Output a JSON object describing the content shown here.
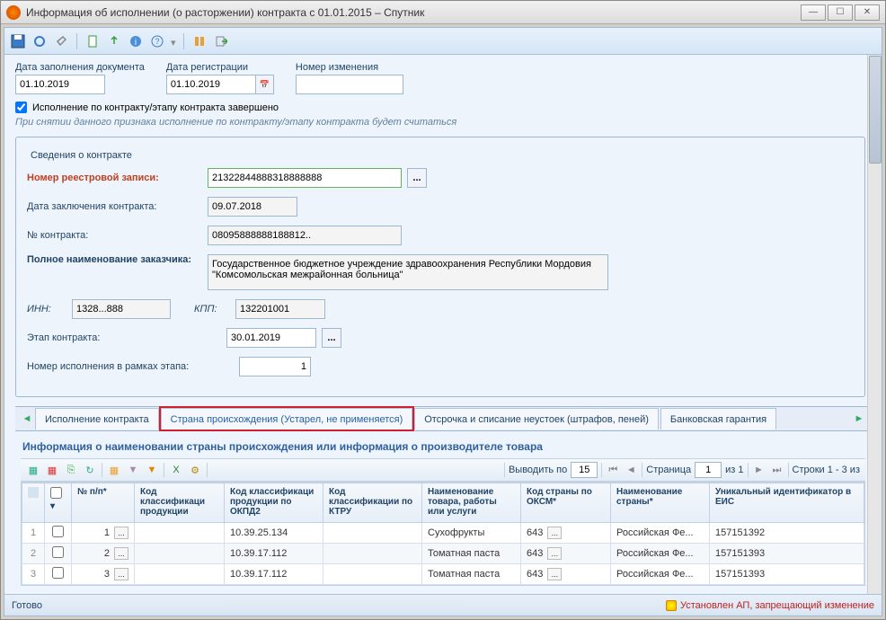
{
  "window": {
    "title": "Информация об исполнении (о расторжении) контракта с 01.01.2015 – Спутник"
  },
  "header": {
    "fill_date_label": "Дата заполнения документа",
    "fill_date": "01.10.2019",
    "reg_date_label": "Дата регистрации",
    "reg_date": "01.10.2019",
    "change_num_label": "Номер изменения",
    "change_num": ""
  },
  "checkbox": {
    "label": "Исполнение по контракту/этапу контракта завершено"
  },
  "note": "При снятии данного признака исполнение по контракту/этапу контракта будет считаться",
  "contract": {
    "legend": "Сведения о контракте",
    "reg_num_label": "Номер реестровой записи:",
    "reg_num": "21322844888318888888",
    "date_label": "Дата заключения контракта:",
    "date": "09.07.2018",
    "num_label": "№ контракта:",
    "num": "08095888888188812..",
    "customer_label": "Полное наименование заказчика:",
    "customer": "Государственное бюджетное учреждение здравоохранения Республики Мордовия \"Комсомольская межрайонная больница\"",
    "inn_label": "ИНН:",
    "inn": "1328...888",
    "kpp_label": "КПП:",
    "kpp": "132201001",
    "stage_label": "Этап контракта:",
    "stage": "30.01.2019",
    "exec_num_label": "Номер исполнения в рамках этапа:",
    "exec_num": "1"
  },
  "tabs": {
    "t1": "Исполнение контракта",
    "t2": "Страна происхождения (Устарел, не применяется)",
    "t3": "Отсрочка и списание неустоек (штрафов, пеней)",
    "t4": "Банковская гарантия"
  },
  "section_title": "Информация о наименовании страны происхождения или информация о производителе товара",
  "pager": {
    "show_by": "Выводить по",
    "show_val": "15",
    "page_lbl": "Страница",
    "page_val": "1",
    "page_of": "из 1",
    "rows": "Строки 1 - 3 из"
  },
  "grid": {
    "cols": {
      "chk": "",
      "num": "№ п/п*",
      "c1": "Код классификаци продукции",
      "c2": "Код классификаци продукции по ОКПД2",
      "c3": "Код классификации по КТРУ",
      "c4": "Наименование товара, работы или услуги",
      "c5": "Код страны по ОКСМ*",
      "c6": "Наименование страны*",
      "c7": "Уникальный идентификатор в ЕИС"
    },
    "rows": [
      {
        "idx": "1",
        "num": "1",
        "c2": "10.39.25.134",
        "c4": "Сухофрукты",
        "c5": "643",
        "c6": "Российская Фе...",
        "c7": "157151392"
      },
      {
        "idx": "2",
        "num": "2",
        "c2": "10.39.17.112",
        "c4": "Томатная паста",
        "c5": "643",
        "c6": "Российская Фе...",
        "c7": "157151393"
      },
      {
        "idx": "3",
        "num": "3",
        "c2": "10.39.17.112",
        "c4": "Томатная паста",
        "c5": "643",
        "c6": "Российская Фе...",
        "c7": "157151393"
      }
    ]
  },
  "status": {
    "ready": "Готово",
    "warn": "Установлен АП, запрещающий изменение"
  }
}
